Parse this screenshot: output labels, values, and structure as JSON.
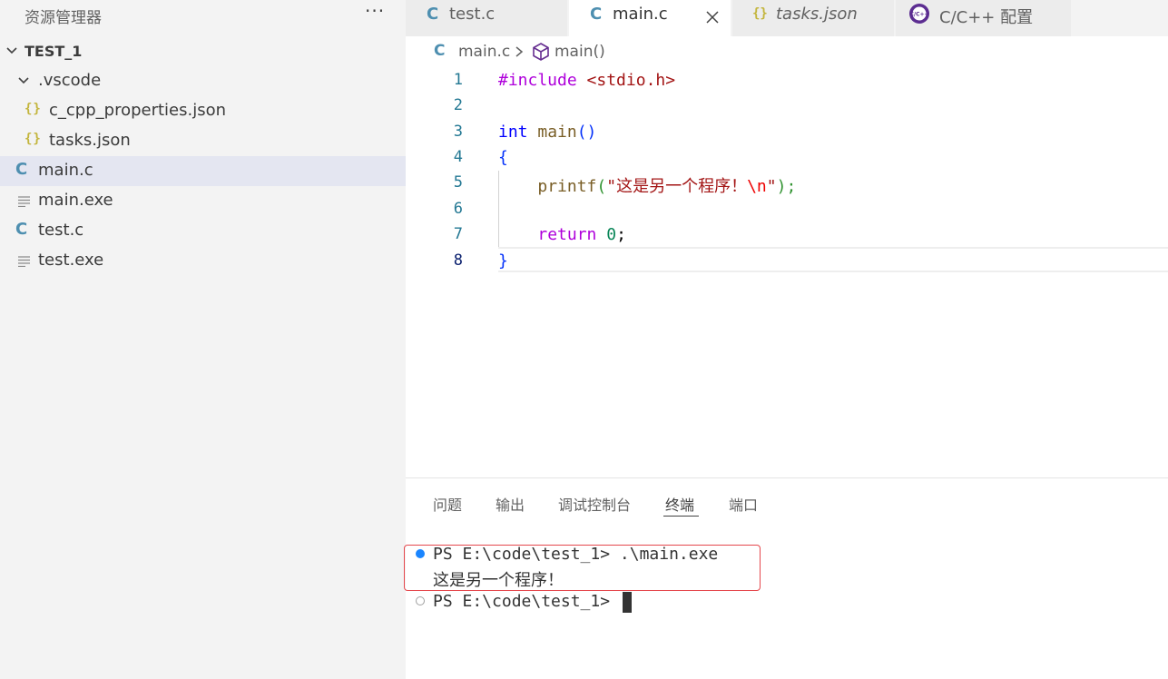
{
  "sidebar": {
    "title": "资源管理器",
    "more": "···",
    "root": "TEST_1",
    "items": [
      {
        "label": ".vscode",
        "icon": "chevron-down-icon"
      },
      {
        "label": "c_cpp_properties.json",
        "icon": "json-icon"
      },
      {
        "label": "tasks.json",
        "icon": "json-icon"
      },
      {
        "label": "main.c",
        "icon": "c-file-icon"
      },
      {
        "label": "main.exe",
        "icon": "file-lines-icon"
      },
      {
        "label": "test.c",
        "icon": "c-file-icon"
      },
      {
        "label": "test.exe",
        "icon": "file-lines-icon"
      }
    ]
  },
  "tabs": [
    {
      "label": "test.c",
      "icon": "C"
    },
    {
      "label": "main.c",
      "icon": "C"
    },
    {
      "label": "tasks.json",
      "icon": "{}"
    },
    {
      "label": "C/C++ 配置",
      "icon": "cpp-config-icon"
    }
  ],
  "breadcrumb": {
    "file_icon": "C",
    "file": "main.c",
    "symbol": "main()"
  },
  "editor": {
    "line_numbers": [
      "1",
      "2",
      "3",
      "4",
      "5",
      "6",
      "7",
      "8"
    ],
    "lines": {
      "l1_directive": "#include",
      "l1_header": "<stdio.h>",
      "l3_type": "int",
      "l3_name": "main",
      "l3_parens": "()",
      "l4_brace": "{",
      "l5_fn": "printf",
      "l5_open": "(",
      "l5_str": "\"这是另一个程序！",
      "l5_esc": "\\n",
      "l5_strclose": "\"",
      "l5_close": ");",
      "l7_kw": "return",
      "l7_num": "0",
      "l7_semi": ";",
      "l8_brace": "}"
    }
  },
  "panel": {
    "tabs": [
      "问题",
      "输出",
      "调试控制台",
      "终端",
      "端口"
    ],
    "active_tab": "终端"
  },
  "terminal": {
    "line1": "PS E:\\code\\test_1> .\\main.exe",
    "line2": "这是另一个程序！",
    "line3": "PS E:\\code\\test_1> "
  },
  "colors": {
    "dot_success": "#1a85ff",
    "dot_idle": "#a0a0a0",
    "highlight": "#e5484d"
  }
}
